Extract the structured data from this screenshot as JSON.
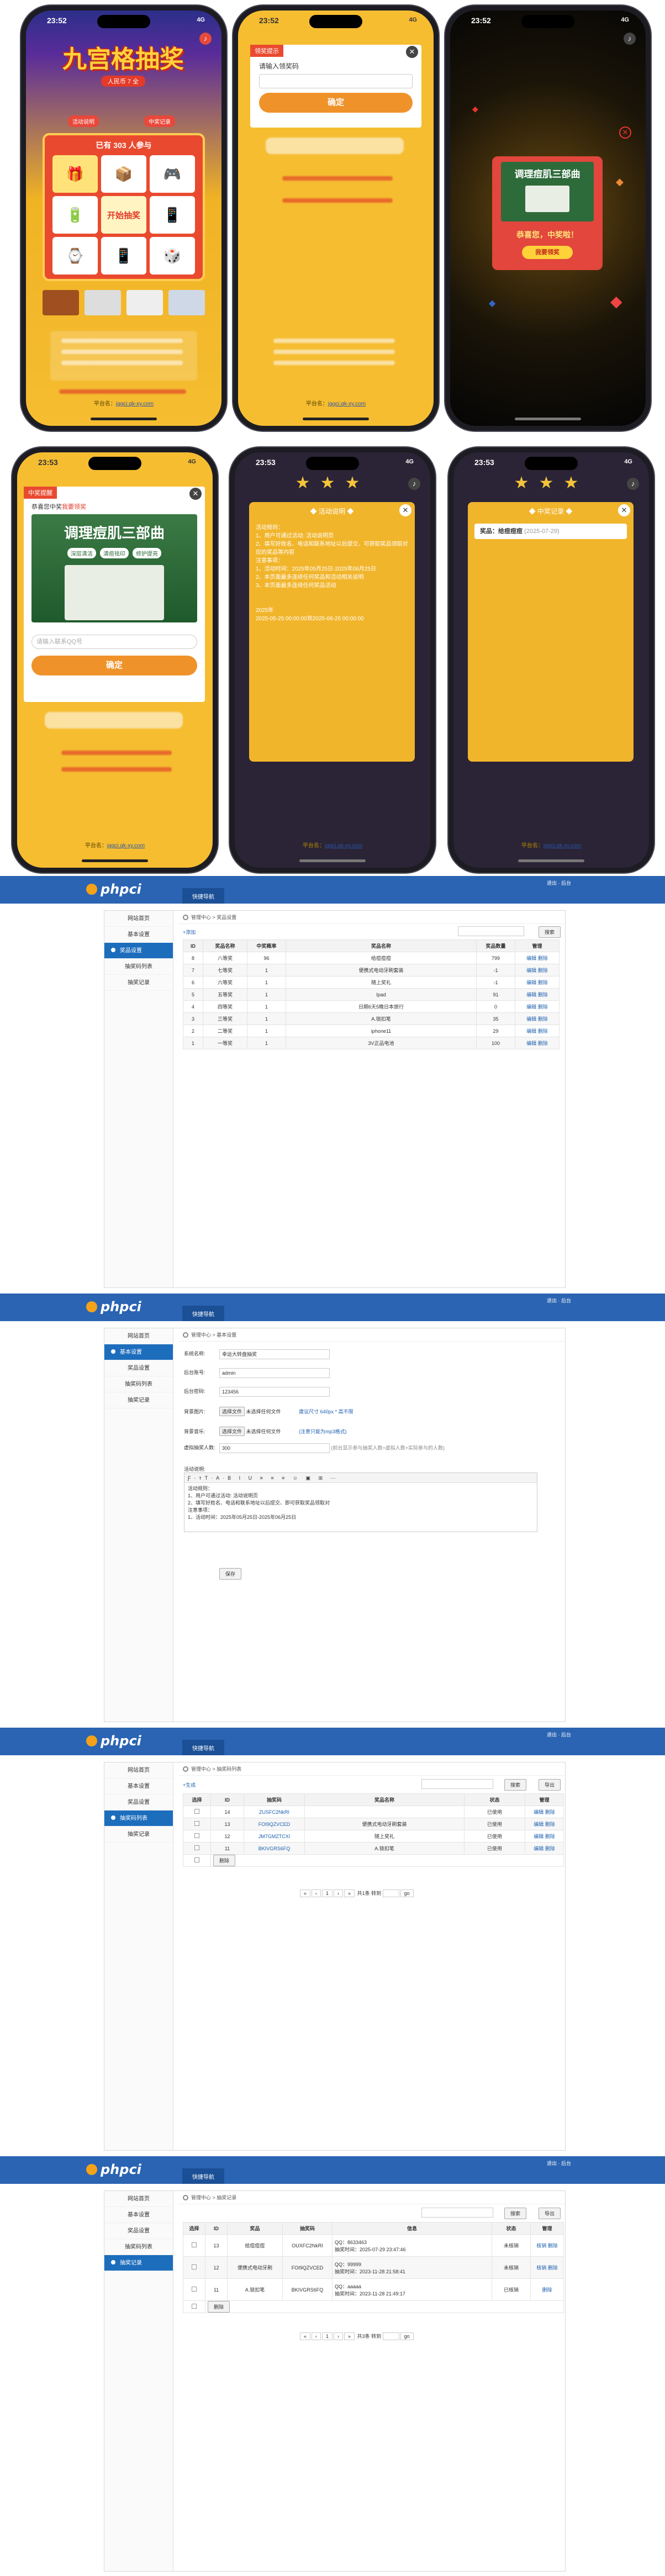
{
  "status": {
    "time1": "23:52",
    "time2": "23:53",
    "signal": "4G"
  },
  "screen1": {
    "logo_big": "九宫格抽奖",
    "logo_small": "人民币 7 全",
    "pill_left": "活动说明",
    "pill_right": "中奖记录",
    "participants": "已有 303 人参与",
    "start_label": "开始抽奖",
    "footer_domain": "jqqci.qk-xy.com",
    "footer_prefix": "平台名："
  },
  "screen2": {
    "dialog_title": "领奖提示",
    "placeholder": "请输入领奖码",
    "confirm": "确定",
    "footer_domain": "jqqci.qk-xy.com",
    "footer_prefix": "平台名："
  },
  "screen3": {
    "card_title": "调理痘肌三部曲",
    "congrats": "恭喜您，中奖啦！",
    "claim": "我要领奖"
  },
  "screen4": {
    "tag": "中奖提醒",
    "congrats_prefix": "恭喜您中奖",
    "congrats_suffix": "我要领奖",
    "prize_title": "调理痘肌三部曲",
    "chips": [
      "深层清洁",
      "清痘祛印",
      "修护提亮"
    ],
    "placeholder": "请输入联系QQ号",
    "confirm": "确定",
    "footer_domain": "jqqci.qk-xy.com",
    "footer_prefix": "平台名："
  },
  "screen5": {
    "panel_title": "活动说明",
    "lines": [
      "活动规则：",
      "1、用户可通过活动: 活动说明页",
      "2、填写好姓名、电话和联系地址以后提交、可获取奖品领取对",
      "应的奖品等内容",
      "注意事项：",
      "1、活动时间：2025年05月25日-2025年06月25日",
      "",
      "2、本页面最多连续任何奖品和活动相关说明",
      "3、本页面最多连续任何奖品活动"
    ],
    "date_label": "2025年",
    "date_range": "2025-05-25 00:00:00到2025-06-25 00:00:00",
    "footer_domain": "jqqci.qk-xy.com",
    "footer_prefix": "平台名："
  },
  "screen6": {
    "panel_title": "中奖记录",
    "record_label": "奖品：",
    "record_prize": "给痘痘痘",
    "record_date": "(2025-07-29)",
    "footer_domain": "jqqci.qk-xy.com",
    "footer_prefix": "平台名："
  },
  "admin_common": {
    "logo": "phpci",
    "quick": "快捷导航",
    "links": "退出 · 后台",
    "crumb_home": "管理中心",
    "menu": [
      "网站首页",
      "基本设置",
      "奖品设置",
      "抽奖码列表",
      "抽奖记录"
    ]
  },
  "admin1": {
    "crumb": "管理中心 > 奖品设置",
    "add_link": "+添加",
    "search_btn": "搜索",
    "headers": [
      "ID",
      "奖品名称",
      "中奖概率",
      "奖品名称",
      "奖品数量",
      "管理"
    ],
    "rows": [
      [
        "8",
        "八等奖",
        "96",
        "给痘痘痘",
        "799",
        "编辑 删除"
      ],
      [
        "7",
        "七等奖",
        "1",
        "便携式电动牙刷套装",
        "-1",
        "编辑 删除"
      ],
      [
        "6",
        "六等奖",
        "1",
        "随上奖礼",
        "-1",
        "编辑 删除"
      ],
      [
        "5",
        "五等奖",
        "1",
        "Ipad",
        "91",
        "编辑 删除"
      ],
      [
        "4",
        "四等奖",
        "1",
        "日期6天5晚日本旅行",
        "0",
        "编辑 删除"
      ],
      [
        "3",
        "三等奖",
        "1",
        "A.锁扣笔",
        "35",
        "编辑 删除"
      ],
      [
        "2",
        "二等奖",
        "1",
        "iphone11",
        "29",
        "编辑 删除"
      ],
      [
        "1",
        "一等奖",
        "1",
        "3V正品电池",
        "100",
        "编辑 删除"
      ]
    ]
  },
  "admin2": {
    "crumb": "管理中心 > 基本设置",
    "fields": [
      {
        "label": "系统名称:",
        "value": "幸运大转盘抽奖"
      },
      {
        "label": "后台账号:",
        "value": "admin"
      },
      {
        "label": "后台密码:",
        "value": "123456"
      }
    ],
    "upload1_label": "背景图片:",
    "upload1_btn": "选择文件",
    "upload1_text": "未选择任何文件",
    "upload1_hint": "建议尺寸 640px * 高不限",
    "upload2_label": "背景音乐:",
    "upload2_btn": "选择文件",
    "upload2_text": "未选择任何文件",
    "upload2_hint": "(注意只能为mp3格式)",
    "limit_label": "虚拟抽奖人数:",
    "limit_value": "300",
    "limit_hint": "(前台显示参与抽奖人数=虚拟人数+实际参与的人数)",
    "editor_label": "活动说明:",
    "editor_lines": [
      "活动规则：",
      "1、用户可通过活动: 活动说明页",
      "2、填写好姓名、电话和联系地址以后提交、即可获取奖品领取对",
      "注意事项：",
      "1、活动时间：2025年05月25日-2025年06月25日"
    ],
    "save": "保存"
  },
  "admin3": {
    "crumb": "管理中心 > 抽奖码列表",
    "add_link": "+生成",
    "search_btn": "搜索",
    "export_btn": "导出",
    "headers": [
      "选择",
      "ID",
      "抽奖码",
      "奖品名称",
      "状态",
      "管理"
    ],
    "rows": [
      [
        "14",
        "ZUSFC2NkRI",
        "",
        "已使用",
        "编辑 删除"
      ],
      [
        "13",
        "FOI9QZVCED",
        "便携式电动牙刷套装",
        "已使用",
        "编辑 删除"
      ],
      [
        "12",
        "JM7GMZTCXI",
        "随上奖礼",
        "已使用",
        "编辑 删除"
      ],
      [
        "11",
        "BKIVGRS6FQ",
        "A.锁扣笔",
        "已使用",
        "编辑 删除"
      ]
    ],
    "delete_btn": "删除",
    "pager": [
      "«",
      "‹",
      "1",
      "›",
      "»"
    ],
    "pager_info": "共1条 转到",
    "pager_go": "go"
  },
  "admin4": {
    "crumb": "管理中心 > 抽奖记录",
    "search_btn": "搜索",
    "export_btn": "导出",
    "headers": [
      "选择",
      "ID",
      "奖品",
      "抽奖码",
      "信息",
      "状态",
      "管理"
    ],
    "rows": [
      [
        "13",
        "给痘痘痘",
        "OUXFC2NkRI",
        "QQ：8633463",
        "抽奖时间：2025-07-29 23:47:46",
        "未核销",
        "核销 删除"
      ],
      [
        "12",
        "便携式电动牙刷",
        "FOI9QZVCED",
        "QQ：99999",
        "抽奖时间：2023-11-28 21:58:41",
        "未核销",
        "核销 删除"
      ],
      [
        "11",
        "A.锁扣笔",
        "BKIVGRS6FQ",
        "QQ：aaaaa",
        "抽奖时间：2023-11-28 21:49:17",
        "已核销",
        "删除"
      ]
    ],
    "delete_btn": "删除",
    "pager": [
      "«",
      "‹",
      "1",
      "›",
      "»"
    ],
    "pager_info": "共3条 转到",
    "pager_go": "go"
  }
}
